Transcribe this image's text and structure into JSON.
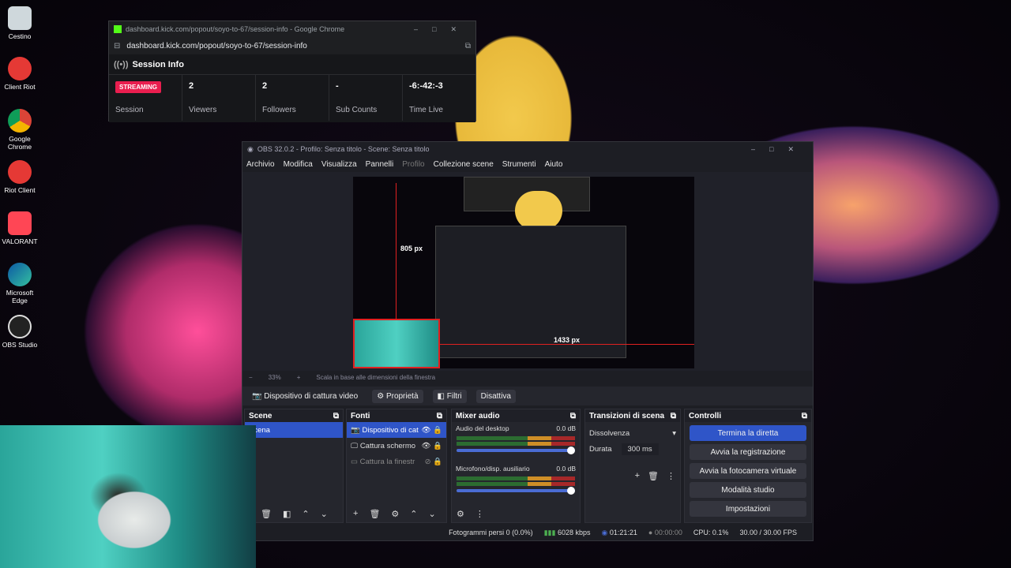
{
  "desktop": {
    "icons": [
      "Cestino",
      "Client Riot",
      "Google Chrome",
      "Riot Client",
      "VALORANT",
      "Microsoft Edge",
      "OBS Studio"
    ]
  },
  "chrome": {
    "title": "dashboard.kick.com/popout/soyo-to-67/session-info - Google Chrome",
    "url": "dashboard.kick.com/popout/soyo-to-67/session-info",
    "session_title": "Session Info",
    "stats": {
      "badge": "STREAMING",
      "session_label": "Session",
      "viewers_value": "2",
      "viewers_label": "Viewers",
      "followers_value": "2",
      "followers_label": "Followers",
      "subs_value": "-",
      "subs_label": "Sub Counts",
      "time_value": "-6:-42:-3",
      "time_label": "Time Live"
    }
  },
  "obs": {
    "title": "OBS 32.0.2 - Profilo: Senza titolo - Scene: Senza titolo",
    "menu": [
      "Archivio",
      "Modifica",
      "Visualizza",
      "Pannelli",
      "Profilo",
      "Collezione scene",
      "Strumenti",
      "Aiuto"
    ],
    "preview_labels": {
      "height": "805 px",
      "width": "1433 px"
    },
    "zoom": "33%",
    "scale_text": "Scala in base alle dimensioni della finestra",
    "source_bar": {
      "name": "Dispositivo di cattura video",
      "properties": "Proprietà",
      "filters": "Filtri",
      "deactivate": "Disattiva"
    },
    "scenes": {
      "title": "Scene",
      "items": [
        "Scena"
      ]
    },
    "sources": {
      "title": "Fonti",
      "items": [
        "Dispositivo di cat",
        "Cattura schermo",
        "Cattura la finestr"
      ]
    },
    "mixer": {
      "title": "Mixer audio",
      "channels": [
        {
          "name": "Audio del desktop",
          "db": "0.0 dB"
        },
        {
          "name": "Microfono/disp. ausiliario",
          "db": "0.0 dB"
        }
      ]
    },
    "transitions": {
      "title": "Transizioni di scena",
      "type": "Dissolvenza",
      "duration_label": "Durata",
      "duration_value": "300 ms"
    },
    "controls": {
      "title": "Controlli",
      "buttons": [
        "Termina la diretta",
        "Avvia la registrazione",
        "Avvia la fotocamera virtuale",
        "Modalità studio",
        "Impostazioni"
      ]
    },
    "status": {
      "dropped": "Fotogrammi persi 0 (0.0%)",
      "bitrate": "6028 kbps",
      "live_time": "01:21:21",
      "rec_time": "00:00:00",
      "cpu": "CPU: 0.1%",
      "fps": "30.00 / 30.00 FPS"
    }
  }
}
